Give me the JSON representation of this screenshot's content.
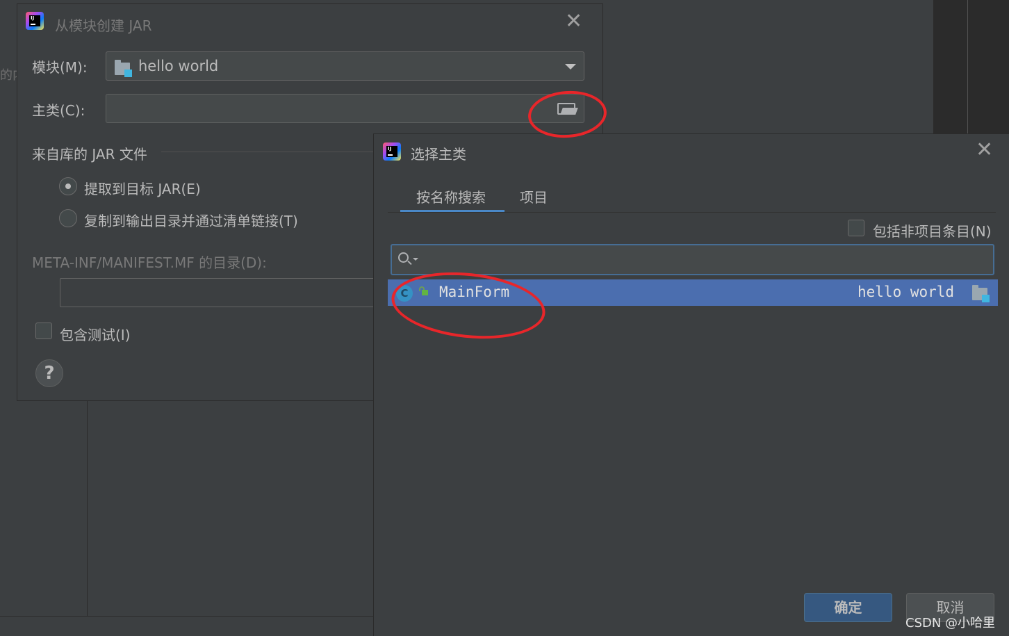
{
  "background": {
    "left_text": "的内"
  },
  "create_jar_dialog": {
    "title": "从模块创建 JAR",
    "module_label": "模块(M):",
    "module_value": "hello world",
    "main_class_label": "主类(C):",
    "main_class_value": "",
    "section_header": "来自库的 JAR 文件",
    "option_extract": "提取到目标 JAR(E)",
    "option_extract_selected": true,
    "option_copy": "复制到输出目录并通过清单链接(T)",
    "option_copy_selected": false,
    "manifest_label": "META-INF/MANIFEST.MF 的目录(D):",
    "include_tests_label": "包含测试(I)",
    "include_tests_checked": false,
    "help_label": "?"
  },
  "choose_main_class_dialog": {
    "title": "选择主类",
    "tabs": [
      {
        "label": "按名称搜索",
        "active": true
      },
      {
        "label": "项目",
        "active": false
      }
    ],
    "include_non_project_label": "包括非项目条目(N)",
    "include_non_project_checked": false,
    "search_value": "",
    "results": [
      {
        "class_icon": "C",
        "name": "MainForm",
        "module": "hello world",
        "selected": true
      }
    ],
    "ok_label": "确定",
    "cancel_label": "取消"
  },
  "watermark": "CSDN @小哈里",
  "colors": {
    "background": "#3c3f41",
    "selection": "#4b6eaf",
    "primary_button": "#365880",
    "annotation": "#e8262a"
  },
  "icons": [
    "intellij-logo-icon",
    "close-icon",
    "module-folder-icon",
    "dropdown-arrow-icon",
    "open-folder-icon",
    "search-icon",
    "class-icon",
    "lock-icon",
    "help-icon"
  ]
}
